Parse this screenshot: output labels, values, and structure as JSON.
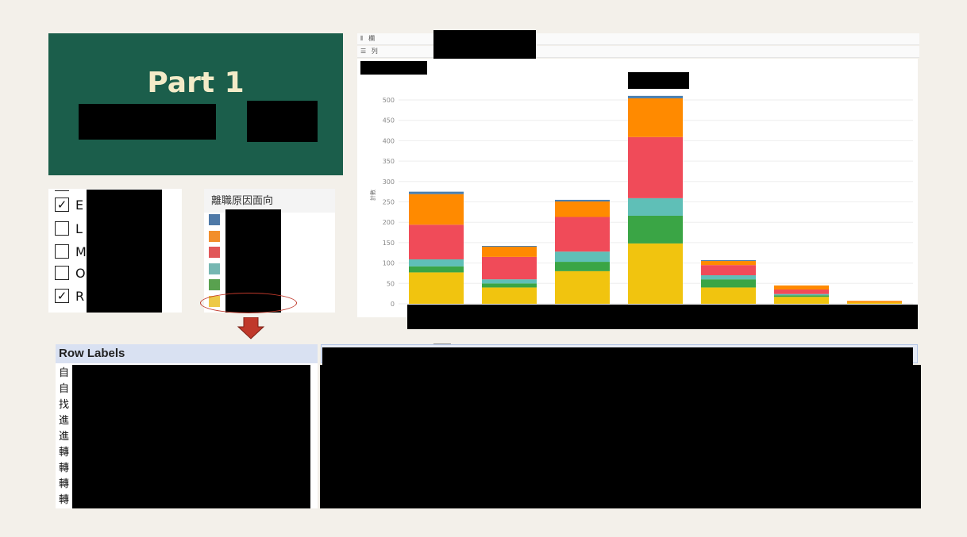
{
  "title_card": {
    "heading": "Part 1",
    "separator": "*"
  },
  "checkbox_panel": {
    "items": [
      {
        "letter": "E",
        "checked": true
      },
      {
        "letter": "L",
        "checked": false
      },
      {
        "letter": "M",
        "checked": false
      },
      {
        "letter": "O",
        "checked": false
      },
      {
        "letter": "R",
        "checked": true
      }
    ],
    "check_mark": "✓"
  },
  "legend_panel": {
    "title": "離職原因面向",
    "colors": [
      "#4e79a7",
      "#f28e2b",
      "#e15759",
      "#76b7b2",
      "#59a14f",
      "#edc948"
    ]
  },
  "chart_shelves": {
    "columns_label": "欄",
    "rows_label": "列"
  },
  "chart_data": {
    "type": "bar",
    "stacked": true,
    "ylabel": "計數",
    "ylim": [
      0,
      520
    ],
    "yticks": [
      0,
      50,
      100,
      150,
      200,
      250,
      300,
      350,
      400,
      450,
      500
    ],
    "grid": true,
    "series_colors": [
      "#f1c40f",
      "#3aa545",
      "#5fbfb7",
      "#f04b59",
      "#ff8a00",
      "#4a7fb0"
    ],
    "series": [
      {
        "values": [
          77,
          40,
          80,
          148,
          40,
          17,
          3
        ]
      },
      {
        "values": [
          15,
          10,
          23,
          68,
          20,
          4,
          0
        ]
      },
      {
        "values": [
          17,
          10,
          25,
          43,
          10,
          3,
          0
        ]
      },
      {
        "values": [
          85,
          55,
          85,
          150,
          25,
          11,
          0
        ]
      },
      {
        "values": [
          75,
          25,
          38,
          95,
          10,
          10,
          4
        ]
      },
      {
        "values": [
          6,
          2,
          4,
          6,
          2,
          0,
          0
        ]
      }
    ]
  },
  "pivot": {
    "header": "Row Labels",
    "filter_icon": "▼",
    "rows": [
      "自",
      "自",
      "找",
      "進",
      "進",
      "轉",
      "轉",
      "轉",
      "轉"
    ]
  }
}
